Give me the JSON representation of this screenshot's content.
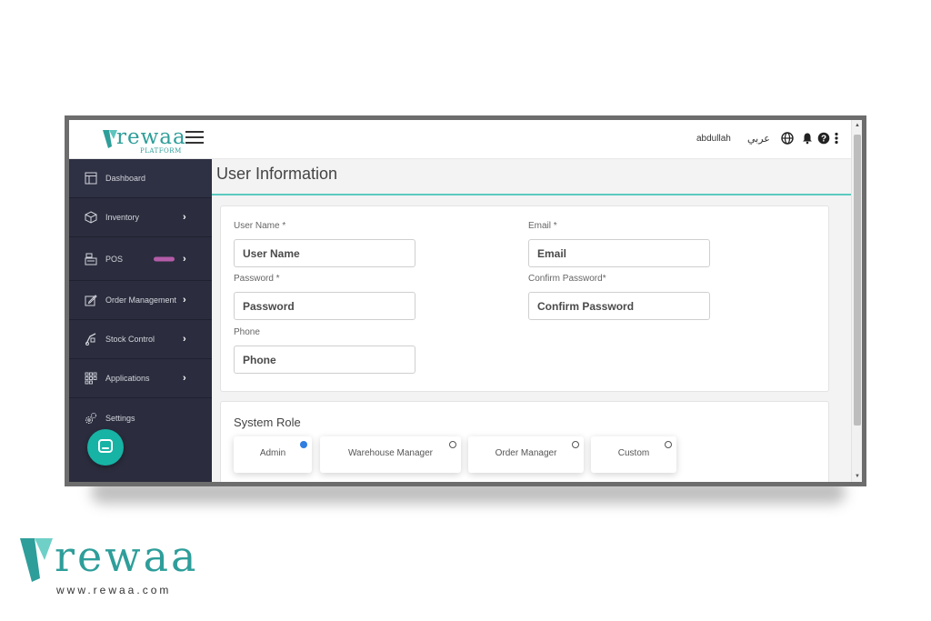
{
  "app": {
    "brand": "rewaa",
    "brand_sub": "PLATFORM"
  },
  "sidebar": {
    "items": [
      {
        "label": "Dashboard",
        "icon": "dashboard-icon"
      },
      {
        "label": "Inventory",
        "icon": "box-icon"
      },
      {
        "label": "POS",
        "icon": "cash-register-icon"
      },
      {
        "label": "Order Management",
        "icon": "edit-icon"
      },
      {
        "label": "Stock Control",
        "icon": "dolly-icon"
      },
      {
        "label": "Applications",
        "icon": "grid-icon"
      },
      {
        "label": "Settings",
        "icon": "gears-icon"
      }
    ]
  },
  "topbar": {
    "user": "abdullah",
    "language": "عربي"
  },
  "page": {
    "title": "User Information"
  },
  "form": {
    "username_label": "User Name *",
    "username_placeholder": "User Name",
    "email_label": "Email *",
    "email_placeholder": "Email",
    "password_label": "Password *",
    "password_placeholder": "Password",
    "confirm_label": "Confirm Password*",
    "confirm_placeholder": "Confirm Password",
    "phone_label": "Phone",
    "phone_placeholder": "Phone"
  },
  "role": {
    "title": "System Role",
    "options": [
      "Admin",
      "Warehouse Manager",
      "Order Manager",
      "Custom"
    ],
    "selected": "Admin"
  },
  "footer": {
    "brand": "rewaa",
    "url": "www.rewaa.com"
  },
  "colors": {
    "accent": "#2e9e9a",
    "sidebar": "#2b2d3e",
    "radio_selected": "#2f7ee0",
    "beta_badge": "#b45ca8"
  }
}
